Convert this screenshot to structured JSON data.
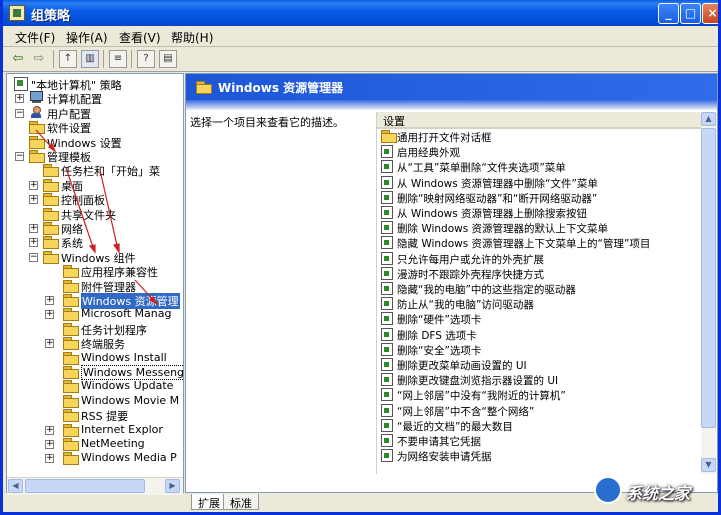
{
  "window": {
    "title": "组策略",
    "buttons": {
      "minimize": "_",
      "maximize": "□",
      "close": "×"
    }
  },
  "menu": [
    "文件(F)",
    "操作(A)",
    "查看(V)",
    "帮助(H)"
  ],
  "tree": {
    "items": [
      {
        "label": "\"本地计算机\" 策略",
        "icon": "policy-icon",
        "expander": "",
        "level": 0
      },
      {
        "label": "计算机配置",
        "icon": "computer-icon",
        "expander": "+",
        "level": 1
      },
      {
        "label": "用户配置",
        "icon": "user-icon",
        "expander": "−",
        "level": 1
      },
      {
        "label": "软件设置",
        "icon": "folder-icon",
        "expander": "",
        "level": 2
      },
      {
        "label": "Windows 设置",
        "icon": "folder-icon",
        "expander": "",
        "level": 2
      },
      {
        "label": "管理模板",
        "icon": "folder-icon",
        "expander": "−",
        "level": 2
      },
      {
        "label": "任务栏和「开始」菜",
        "icon": "folder-icon",
        "expander": "",
        "level": 3
      },
      {
        "label": "桌面",
        "icon": "folder-icon",
        "expander": "+",
        "level": 3
      },
      {
        "label": "控制面板",
        "icon": "folder-icon",
        "expander": "+",
        "level": 3
      },
      {
        "label": "共享文件夹",
        "icon": "folder-icon",
        "expander": "",
        "level": 3
      },
      {
        "label": "网络",
        "icon": "folder-icon",
        "expander": "+",
        "level": 3
      },
      {
        "label": "系统",
        "icon": "folder-icon",
        "expander": "+",
        "level": 3
      },
      {
        "label": "Windows 组件",
        "icon": "folder-icon",
        "expander": "−",
        "level": 3
      },
      {
        "label": "应用程序兼容性",
        "icon": "folder-icon",
        "expander": "",
        "level": 4
      },
      {
        "label": "附件管理器",
        "icon": "folder-icon",
        "expander": "",
        "level": 4
      },
      {
        "label": "Windows 资源管理",
        "icon": "folder-icon",
        "expander": "+",
        "level": 4,
        "selected": true
      },
      {
        "label": "Microsoft Manag",
        "icon": "folder-icon",
        "expander": "+",
        "level": 4
      },
      {
        "label": "任务计划程序",
        "icon": "folder-icon",
        "expander": "",
        "level": 4
      },
      {
        "label": "终端服务",
        "icon": "folder-icon",
        "expander": "+",
        "level": 4
      },
      {
        "label": "Windows Install",
        "icon": "folder-icon",
        "expander": "",
        "level": 4
      },
      {
        "label": "Windows Messenger",
        "icon": "folder-icon",
        "expander": "",
        "level": 4,
        "boxed": true
      },
      {
        "label": "Windows Update",
        "icon": "folder-icon",
        "expander": "",
        "level": 4
      },
      {
        "label": "Windows Movie M",
        "icon": "folder-icon",
        "expander": "",
        "level": 4
      },
      {
        "label": "RSS 提要",
        "icon": "folder-icon",
        "expander": "",
        "level": 4
      },
      {
        "label": "Internet Explor",
        "icon": "folder-icon",
        "expander": "+",
        "level": 4
      },
      {
        "label": "NetMeeting",
        "icon": "folder-icon",
        "expander": "+",
        "level": 4
      },
      {
        "label": "Windows Media P",
        "icon": "folder-icon",
        "expander": "+",
        "level": 4
      }
    ]
  },
  "details": {
    "header_title": "Windows 资源管理器",
    "description": "选择一个项目来查看它的描述。",
    "column_header": "设置",
    "settings": [
      {
        "label": "通用打开文件对话框",
        "icon": "folder-icon"
      },
      {
        "label": "启用经典外观",
        "icon": "setting-icon"
      },
      {
        "label": "从“工具”菜单删除“文件夹选项”菜单",
        "icon": "setting-icon"
      },
      {
        "label": "从 Windows 资源管理器中删除“文件”菜单",
        "icon": "setting-icon"
      },
      {
        "label": "删除“映射网络驱动器”和“断开网络驱动器”",
        "icon": "setting-icon"
      },
      {
        "label": "从 Windows 资源管理器上删除搜索按钮",
        "icon": "setting-icon"
      },
      {
        "label": "删除 Windows 资源管理器的默认上下文菜单",
        "icon": "setting-icon"
      },
      {
        "label": "隐藏 Windows 资源管理器上下文菜单上的“管理”项目",
        "icon": "setting-icon"
      },
      {
        "label": "只允许每用户或允许的外壳扩展",
        "icon": "setting-icon"
      },
      {
        "label": "漫游时不跟踪外壳程序快捷方式",
        "icon": "setting-icon"
      },
      {
        "label": "隐藏“我的电脑”中的这些指定的驱动器",
        "icon": "setting-icon"
      },
      {
        "label": "防止从“我的电脑”访问驱动器",
        "icon": "setting-icon"
      },
      {
        "label": "删除“硬件”选项卡",
        "icon": "setting-icon"
      },
      {
        "label": "删除 DFS 选项卡",
        "icon": "setting-icon"
      },
      {
        "label": "删除“安全”选项卡",
        "icon": "setting-icon"
      },
      {
        "label": "删除更改菜单动画设置的 UI",
        "icon": "setting-icon"
      },
      {
        "label": "删除更改键盘浏览指示器设置的 UI",
        "icon": "setting-icon"
      },
      {
        "label": "“网上邻居”中没有“我附近的计算机”",
        "icon": "setting-icon"
      },
      {
        "label": "“网上邻居”中不含“整个网络”",
        "icon": "setting-icon"
      },
      {
        "label": "“最近的文档”的最大数目",
        "icon": "setting-icon"
      },
      {
        "label": "不要申请其它凭据",
        "icon": "setting-icon"
      },
      {
        "label": "为网络安装申请凭据",
        "icon": "setting-icon"
      }
    ]
  },
  "tabs": [
    "扩展",
    "标准"
  ],
  "watermark": "系统之家",
  "colors": {
    "accent": "#316ac5",
    "titlebar": "#0a5ce6",
    "annotation": "#cc2020"
  }
}
